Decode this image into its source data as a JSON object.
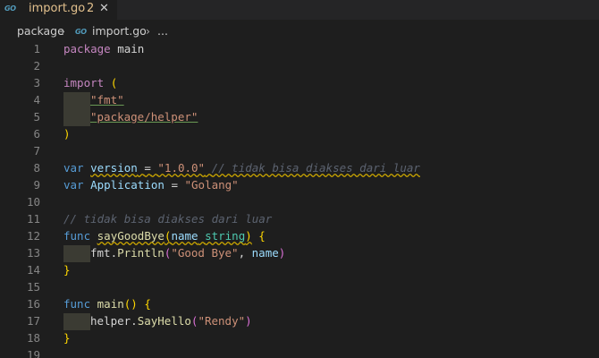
{
  "tab": {
    "icon_text": "GO",
    "title": "import.go",
    "problem_count": "2",
    "close_glyph": "✕"
  },
  "breadcrumb": {
    "items": [
      "package",
      "import.go",
      "..."
    ],
    "separator": "›",
    "file_icon_text": "GO"
  },
  "editor": {
    "line_numbers": [
      "1",
      "2",
      "3",
      "4",
      "5",
      "6",
      "7",
      "8",
      "9",
      "10",
      "11",
      "12",
      "13",
      "14",
      "15",
      "16",
      "17",
      "18",
      "19"
    ],
    "tokens": {
      "package_kw": "package",
      "package_name": "main",
      "import_kw": "import",
      "open_paren": "(",
      "close_paren": ")",
      "fmt_import": "\"fmt\"",
      "helper_import": "\"package/helper\"",
      "var_kw": "var",
      "version_name": "version",
      "equals": "=",
      "version_value": "\"1.0.0\"",
      "version_comment": "// tidak bisa diakses dari luar",
      "application_name": "Application",
      "application_value": "\"Golang\"",
      "comment_line": "// tidak bisa diakses dari luar",
      "func_kw": "func",
      "saygoodbye_name": "sayGoodBye",
      "param_name": "name",
      "param_type": "string",
      "open_brace": "{",
      "close_brace": "}",
      "fmt_pkg": "fmt",
      "dot": ".",
      "println_fn": "Println",
      "goodbye_str": "\"Good Bye\"",
      "comma": ",",
      "name_arg": "name",
      "main_name": "main",
      "empty_parens": "()",
      "helper_pkg": "helper",
      "sayhello_fn": "SayHello",
      "rendy_str": "\"Rendy\""
    }
  },
  "colors": {
    "background": "#1e1e1e",
    "keyword": "#c586c0",
    "storage": "#569cd6",
    "function": "#dcdcaa",
    "variable": "#9cdcfe",
    "string": "#ce9178",
    "comment": "#5c6370",
    "warning_squiggle": "#cca700",
    "modified_tab_text": "#e2c08d"
  }
}
